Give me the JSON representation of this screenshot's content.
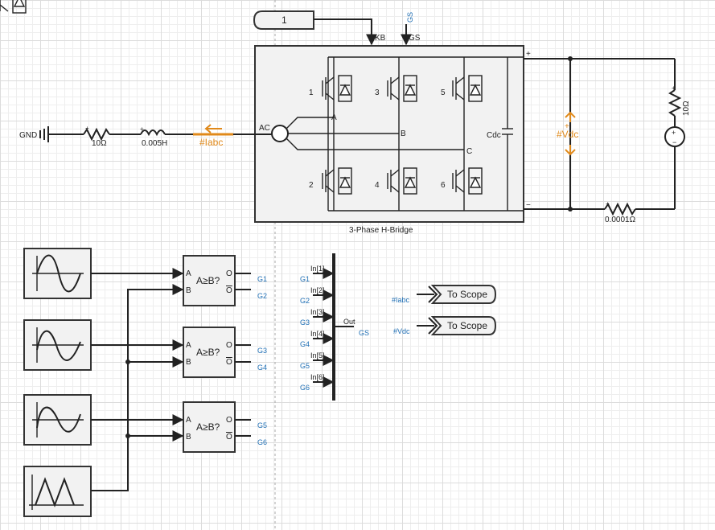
{
  "const_block": {
    "value": "1"
  },
  "bridge": {
    "title": "3-Phase H-Bridge",
    "kb_label": "KB",
    "gs_label": "GS",
    "gs_top_label": "GS",
    "ac_label": "AC",
    "phase_a": "A",
    "phase_b": "B",
    "phase_c": "C",
    "cdc_label": "Cdc",
    "plus": "+",
    "minus": "−",
    "switches": [
      "1",
      "3",
      "5",
      "2",
      "4",
      "6"
    ]
  },
  "source_chain": {
    "gnd": "GND",
    "resistor": "10Ω",
    "inductor": "0.005H",
    "current_probe": "#Iabc"
  },
  "dc_side": {
    "voltage_probe": "#Vdc",
    "load_resistor": "10Ω",
    "series_resistor": "0.0001Ω"
  },
  "comparators": [
    {
      "a": "A",
      "b": "B",
      "label": "A≥B?",
      "o": "O",
      "ob": "O",
      "out1": "G1",
      "out2": "G2"
    },
    {
      "a": "A",
      "b": "B",
      "label": "A≥B?",
      "o": "O",
      "ob": "O",
      "out1": "G3",
      "out2": "G4"
    },
    {
      "a": "A",
      "b": "B",
      "label": "A≥B?",
      "o": "O",
      "ob": "O",
      "out1": "G5",
      "out2": "G6"
    }
  ],
  "mux": {
    "inputs": [
      "In[1]",
      "In[2]",
      "In[3]",
      "In[4]",
      "In[5]",
      "In[6]"
    ],
    "gates": [
      "G1",
      "G2",
      "G3",
      "G4",
      "G5",
      "G6"
    ],
    "out_label": "Out",
    "out_signal": "GS"
  },
  "scopes": [
    {
      "signal": "#Iabc",
      "label": "To Scope"
    },
    {
      "signal": "#Vdc",
      "label": "To Scope"
    }
  ],
  "colors": {
    "probe": "#e0891a",
    "signal_label": "#1f6fb5",
    "wire": "#222222",
    "block_fill": "#f2f2f2"
  }
}
